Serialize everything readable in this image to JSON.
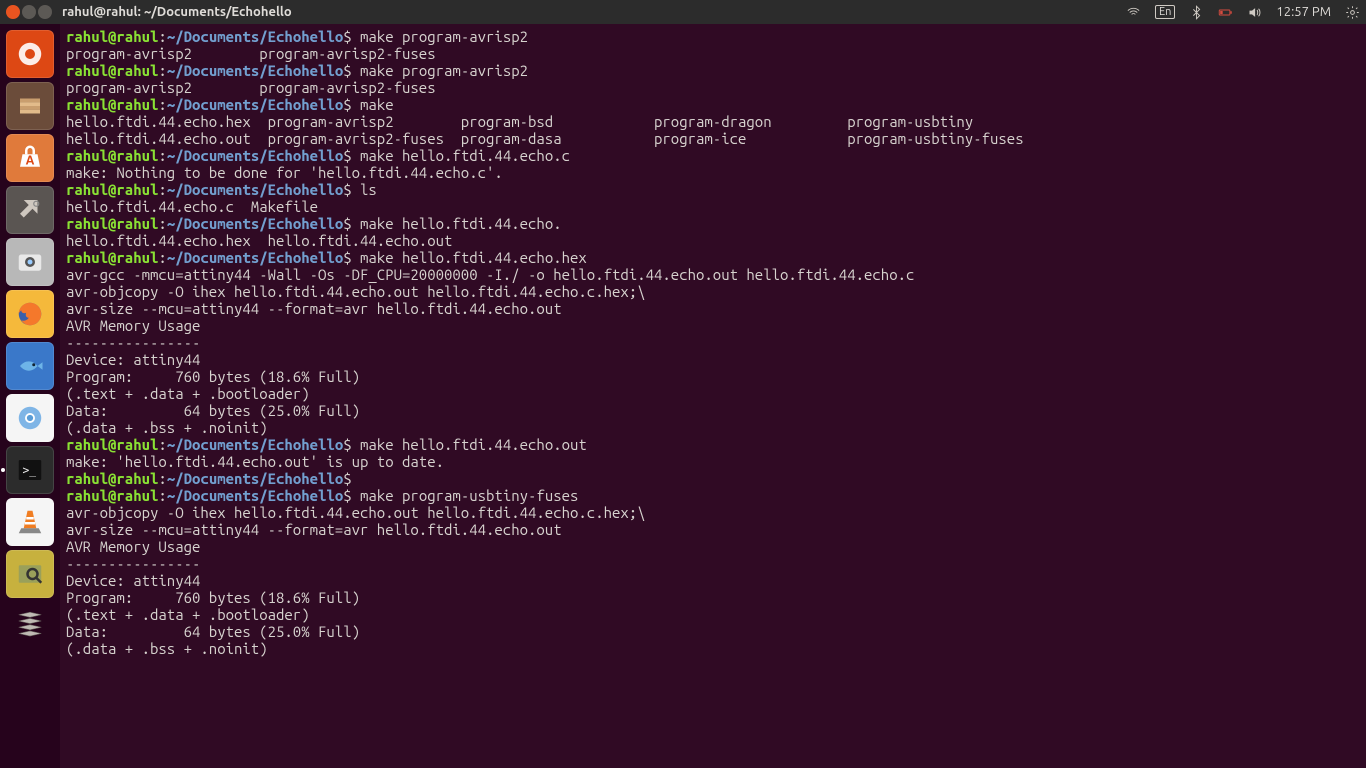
{
  "menubar": {
    "title": "rahul@rahul: ~/Documents/Echohello",
    "lang": "En",
    "time": "12:57 PM"
  },
  "launcher": {
    "items": [
      {
        "name": "dash",
        "color": "#dd4814"
      },
      {
        "name": "files",
        "color": "#6b4c3a"
      },
      {
        "name": "software",
        "color": "#e07a3b"
      },
      {
        "name": "settings",
        "color": "#5a5552"
      },
      {
        "name": "camera-app",
        "color": "#b8b8b8"
      },
      {
        "name": "firefox",
        "color": "#f5b93b"
      },
      {
        "name": "bluefish",
        "color": "#3a78c9"
      },
      {
        "name": "chromium",
        "color": "#6fa7dc"
      },
      {
        "name": "terminal",
        "color": "#2c2c2c"
      },
      {
        "name": "vlc",
        "color": "#f59b22"
      },
      {
        "name": "image-viewer",
        "color": "#c7b13e"
      },
      {
        "name": "workspace-switcher",
        "color": "#5f5a57"
      }
    ]
  },
  "prompt": {
    "user": "rahul@rahul",
    "sep": ":",
    "path": "~/Documents/Echohello",
    "end": "$"
  },
  "lines": [
    {
      "t": "p",
      "cmd": "make program-avrisp2"
    },
    {
      "t": "o",
      "text": "program-avrisp2        program-avrisp2-fuses"
    },
    {
      "t": "p",
      "cmd": "make program-avrisp2"
    },
    {
      "t": "o",
      "text": "program-avrisp2        program-avrisp2-fuses"
    },
    {
      "t": "p",
      "cmd": "make"
    },
    {
      "t": "o",
      "text": "hello.ftdi.44.echo.hex  program-avrisp2        program-bsd            program-dragon         program-usbtiny"
    },
    {
      "t": "o",
      "text": "hello.ftdi.44.echo.out  program-avrisp2-fuses  program-dasa           program-ice            program-usbtiny-fuses"
    },
    {
      "t": "p",
      "cmd": "make hello.ftdi.44.echo.c"
    },
    {
      "t": "o",
      "text": "make: Nothing to be done for 'hello.ftdi.44.echo.c'."
    },
    {
      "t": "p",
      "cmd": "ls"
    },
    {
      "t": "o",
      "text": "hello.ftdi.44.echo.c  Makefile"
    },
    {
      "t": "p",
      "cmd": "make hello.ftdi.44.echo."
    },
    {
      "t": "o",
      "text": "hello.ftdi.44.echo.hex  hello.ftdi.44.echo.out"
    },
    {
      "t": "p",
      "cmd": "make hello.ftdi.44.echo.hex"
    },
    {
      "t": "o",
      "text": "avr-gcc -mmcu=attiny44 -Wall -Os -DF_CPU=20000000 -I./ -o hello.ftdi.44.echo.out hello.ftdi.44.echo.c"
    },
    {
      "t": "o",
      "text": "avr-objcopy -O ihex hello.ftdi.44.echo.out hello.ftdi.44.echo.c.hex;\\"
    },
    {
      "t": "o",
      "text": "avr-size --mcu=attiny44 --format=avr hello.ftdi.44.echo.out"
    },
    {
      "t": "o",
      "text": "AVR Memory Usage"
    },
    {
      "t": "o",
      "text": "----------------"
    },
    {
      "t": "o",
      "text": "Device: attiny44"
    },
    {
      "t": "o",
      "text": ""
    },
    {
      "t": "o",
      "text": "Program:     760 bytes (18.6% Full)"
    },
    {
      "t": "o",
      "text": "(.text + .data + .bootloader)"
    },
    {
      "t": "o",
      "text": ""
    },
    {
      "t": "o",
      "text": "Data:         64 bytes (25.0% Full)"
    },
    {
      "t": "o",
      "text": "(.data + .bss + .noinit)"
    },
    {
      "t": "o",
      "text": ""
    },
    {
      "t": "o",
      "text": ""
    },
    {
      "t": "p",
      "cmd": "make hello.ftdi.44.echo.out"
    },
    {
      "t": "o",
      "text": "make: 'hello.ftdi.44.echo.out' is up to date."
    },
    {
      "t": "p",
      "cmd": ""
    },
    {
      "t": "p",
      "cmd": "make program-usbtiny-fuses"
    },
    {
      "t": "o",
      "text": "avr-objcopy -O ihex hello.ftdi.44.echo.out hello.ftdi.44.echo.c.hex;\\"
    },
    {
      "t": "o",
      "text": "avr-size --mcu=attiny44 --format=avr hello.ftdi.44.echo.out"
    },
    {
      "t": "o",
      "text": "AVR Memory Usage"
    },
    {
      "t": "o",
      "text": "----------------"
    },
    {
      "t": "o",
      "text": "Device: attiny44"
    },
    {
      "t": "o",
      "text": ""
    },
    {
      "t": "o",
      "text": "Program:     760 bytes (18.6% Full)"
    },
    {
      "t": "o",
      "text": "(.text + .data + .bootloader)"
    },
    {
      "t": "o",
      "text": ""
    },
    {
      "t": "o",
      "text": "Data:         64 bytes (25.0% Full)"
    },
    {
      "t": "o",
      "text": "(.data + .bss + .noinit)"
    }
  ]
}
